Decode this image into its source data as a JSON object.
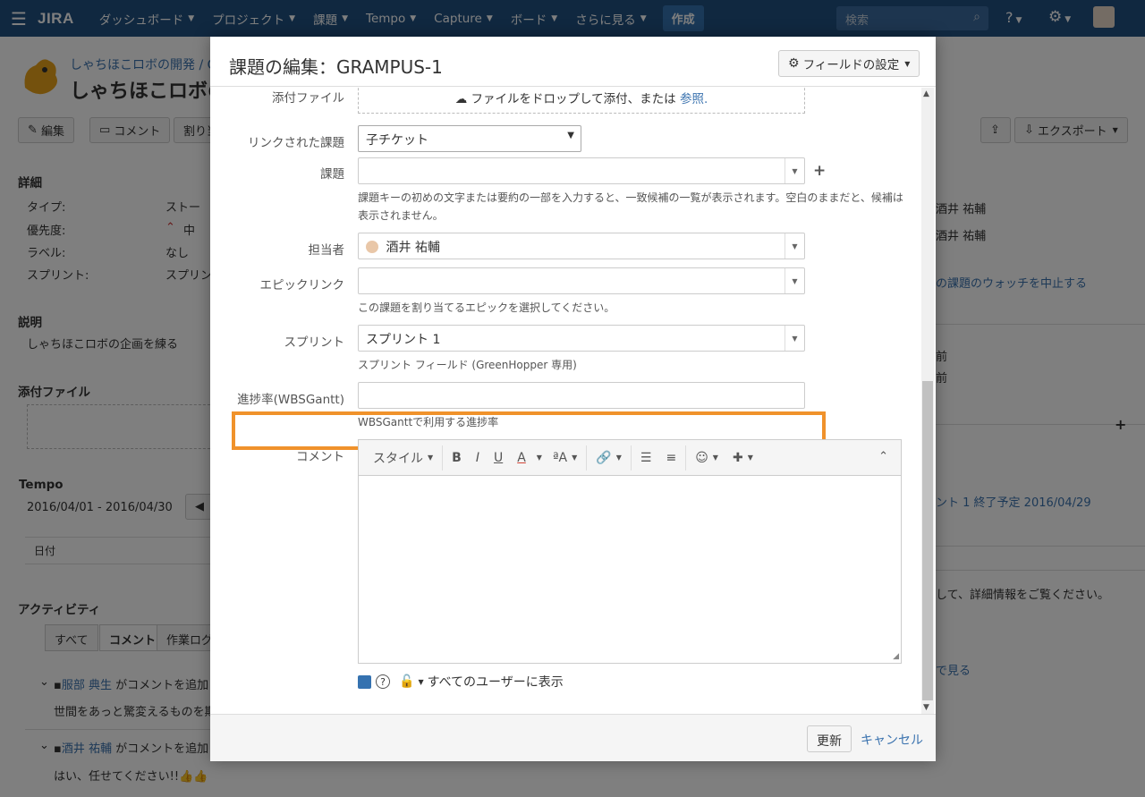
{
  "topnav": {
    "logo": "JIRA",
    "items": [
      "ダッシュボード",
      "プロジェクト",
      "課題",
      "Tempo",
      "Capture",
      "ボード",
      "さらに見る"
    ],
    "create": "作成",
    "search_placeholder": "検索"
  },
  "background": {
    "breadcrumb": "しゃちほこロボの開発 / G",
    "title": "しゃちほこロボの",
    "buttons": {
      "edit": "編集",
      "comment": "コメント",
      "assign": "割り当",
      "export": "エクスポート"
    },
    "details_head": "詳細",
    "details": [
      {
        "label": "タイプ:",
        "value": "ストー"
      },
      {
        "label": "優先度:",
        "value": "中"
      },
      {
        "label": "ラベル:",
        "value": "なし"
      },
      {
        "label": "スプリント:",
        "value": "スプリン"
      }
    ],
    "description_head": "説明",
    "description": "しゃちほこロボの企画を練る",
    "attachments_head": "添付ファイル",
    "tempo_head": "Tempo",
    "tempo_range": "2016/04/01 - 2016/04/30",
    "date_col": "日付",
    "activity_head": "アクティビティ",
    "activity_tabs": [
      "すべて",
      "コメント",
      "作業ログ"
    ],
    "comments": [
      {
        "user": "服部 典生",
        "action": "がコメントを追加",
        "text": "世間をあっと驚変えるものを期"
      },
      {
        "user": "酒井 祐輔",
        "action": "がコメントを追加",
        "text": "はい、任せてください!!👍👍"
      }
    ],
    "right": {
      "person1": "酒井 祐輔",
      "person2": "酒井 祐輔",
      "watch": "の課題のウォッチを中止する",
      "date1": "前",
      "date2": "前",
      "sprint": "ント 1 終了予定 2016/04/29",
      "info": "して、詳細情報をご覧ください。",
      "view": "で見る"
    }
  },
  "dialog": {
    "title": "課題の編集：GRAMPUS-1",
    "field_settings": "フィールドの設定",
    "attachment": {
      "label": "添付ファイル",
      "drop_text": "ファイルをドロップして添付、または",
      "browse": "参照."
    },
    "linked_issues": {
      "label": "リンクされた課題",
      "value": "子チケット"
    },
    "issue": {
      "label": "課題",
      "help": "課題キーの初めの文字または要約の一部を入力すると、一致候補の一覧が表示されます。空白のままだと、候補は表示されません。"
    },
    "assignee": {
      "label": "担当者",
      "value": "酒井 祐輔"
    },
    "epic_link": {
      "label": "エピックリンク",
      "help": "この課題を割り当てるエピックを選択してください。"
    },
    "sprint": {
      "label": "スプリント",
      "value": "スプリント 1",
      "help": "スプリント フィールド (GreenHopper 専用)"
    },
    "progress": {
      "label": "進捗率(WBSGantt)",
      "value": "",
      "help": "WBSGanttで利用する進捗率"
    },
    "comment": {
      "label": "コメント",
      "toolbar": {
        "style": "スタイル"
      },
      "visibility": "すべてのユーザーに表示"
    },
    "update": "更新",
    "cancel": "キャンセル"
  }
}
